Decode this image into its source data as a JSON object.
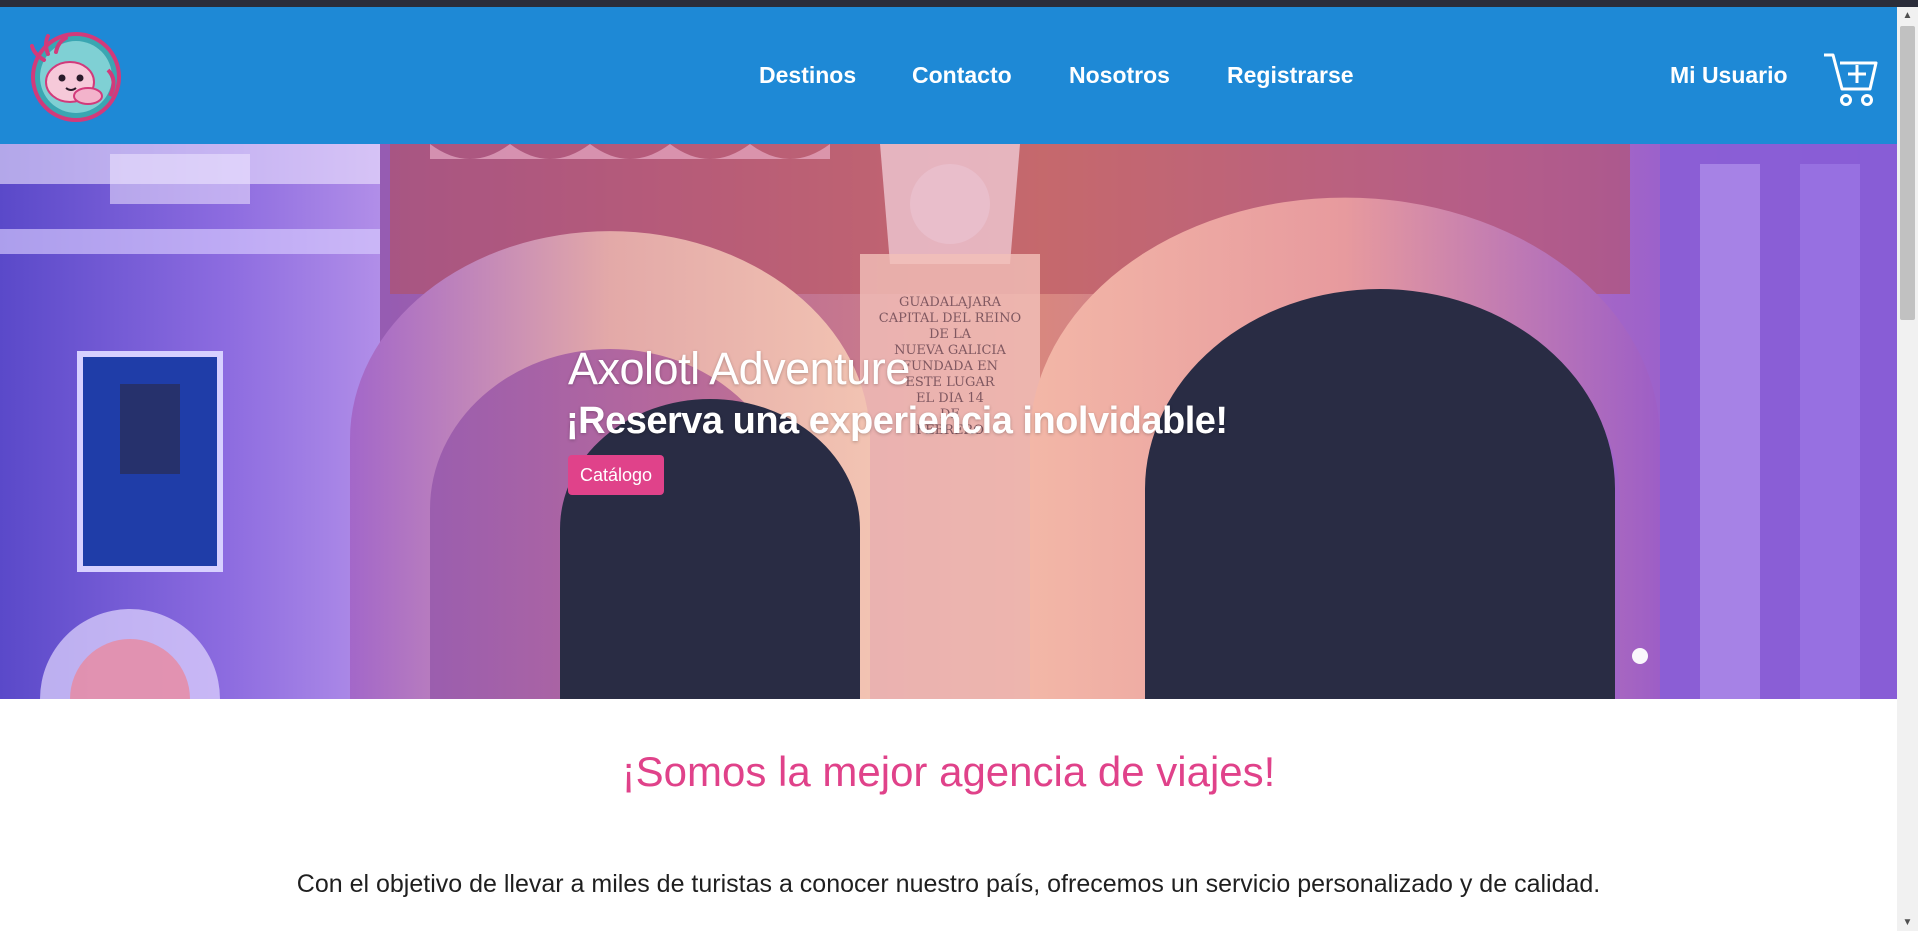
{
  "navbar": {
    "logo_name": "axolotl-logo",
    "links": [
      {
        "label": "Destinos"
      },
      {
        "label": "Contacto"
      },
      {
        "label": "Nosotros"
      },
      {
        "label": "Registrarse"
      }
    ],
    "user_label": "Mi Usuario",
    "cart_icon": "add-to-cart-icon"
  },
  "hero": {
    "title": "Axolotl Adventure",
    "subtitle": "¡Reserva una experiencia inolvidable!",
    "button_label": "Catálogo",
    "inscription": [
      "GUADALAJARA",
      "CAPITAL DEL REINO",
      "DE LA",
      "NUEVA GALICIA",
      "FUNDADA EN",
      "ESTE LUGAR",
      "EL DIA 14",
      "DE",
      "FEBRERO"
    ]
  },
  "about": {
    "title": "¡Somos la mejor agencia de viajes!",
    "text": "Con el objetivo de llevar a miles de turistas a conocer nuestro país, ofrecemos un servicio personalizado y de calidad."
  },
  "colors": {
    "navbar": "#1e89d6",
    "accent": "#e0428a",
    "text": "#1f1f1f"
  }
}
